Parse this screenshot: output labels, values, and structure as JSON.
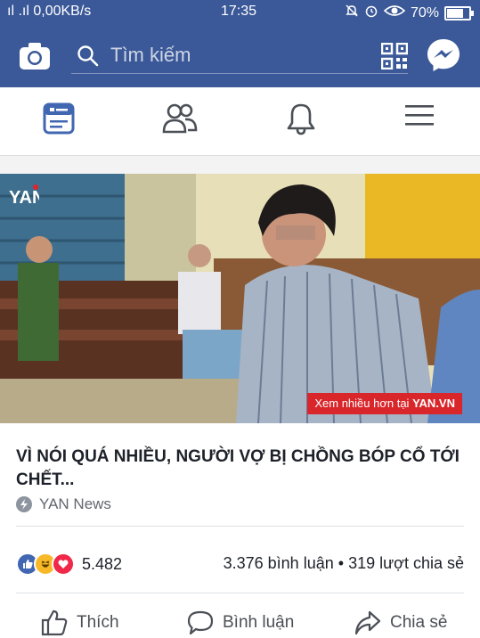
{
  "status_bar": {
    "signal": "ıl .ıl",
    "data_rate": "0,00KB/s",
    "time": "17:35",
    "battery": "70%"
  },
  "top_bar": {
    "search_placeholder": "Tìm kiếm"
  },
  "post": {
    "photo_overlay_prefix": "Xem nhiều hơn tại ",
    "photo_overlay_brand": "YAN.VN",
    "photo_logo_text": "YAN",
    "headline": "VÌ NÓI QUÁ NHIỀU, NGƯỜI VỢ BỊ CHỒNG BÓP CỔ TỚI CHẾT...",
    "source": "YAN News",
    "reaction_count": "5.482",
    "comments": "3.376 bình luận",
    "shares": "319 lượt chia sẻ",
    "separator": "•"
  },
  "actions": {
    "like": "Thích",
    "comment": "Bình luận",
    "share": "Chia sẻ"
  },
  "colors": {
    "brand_blue": "#3b5998",
    "tab_active": "#4267b2",
    "overlay_red": "#d9262b"
  }
}
